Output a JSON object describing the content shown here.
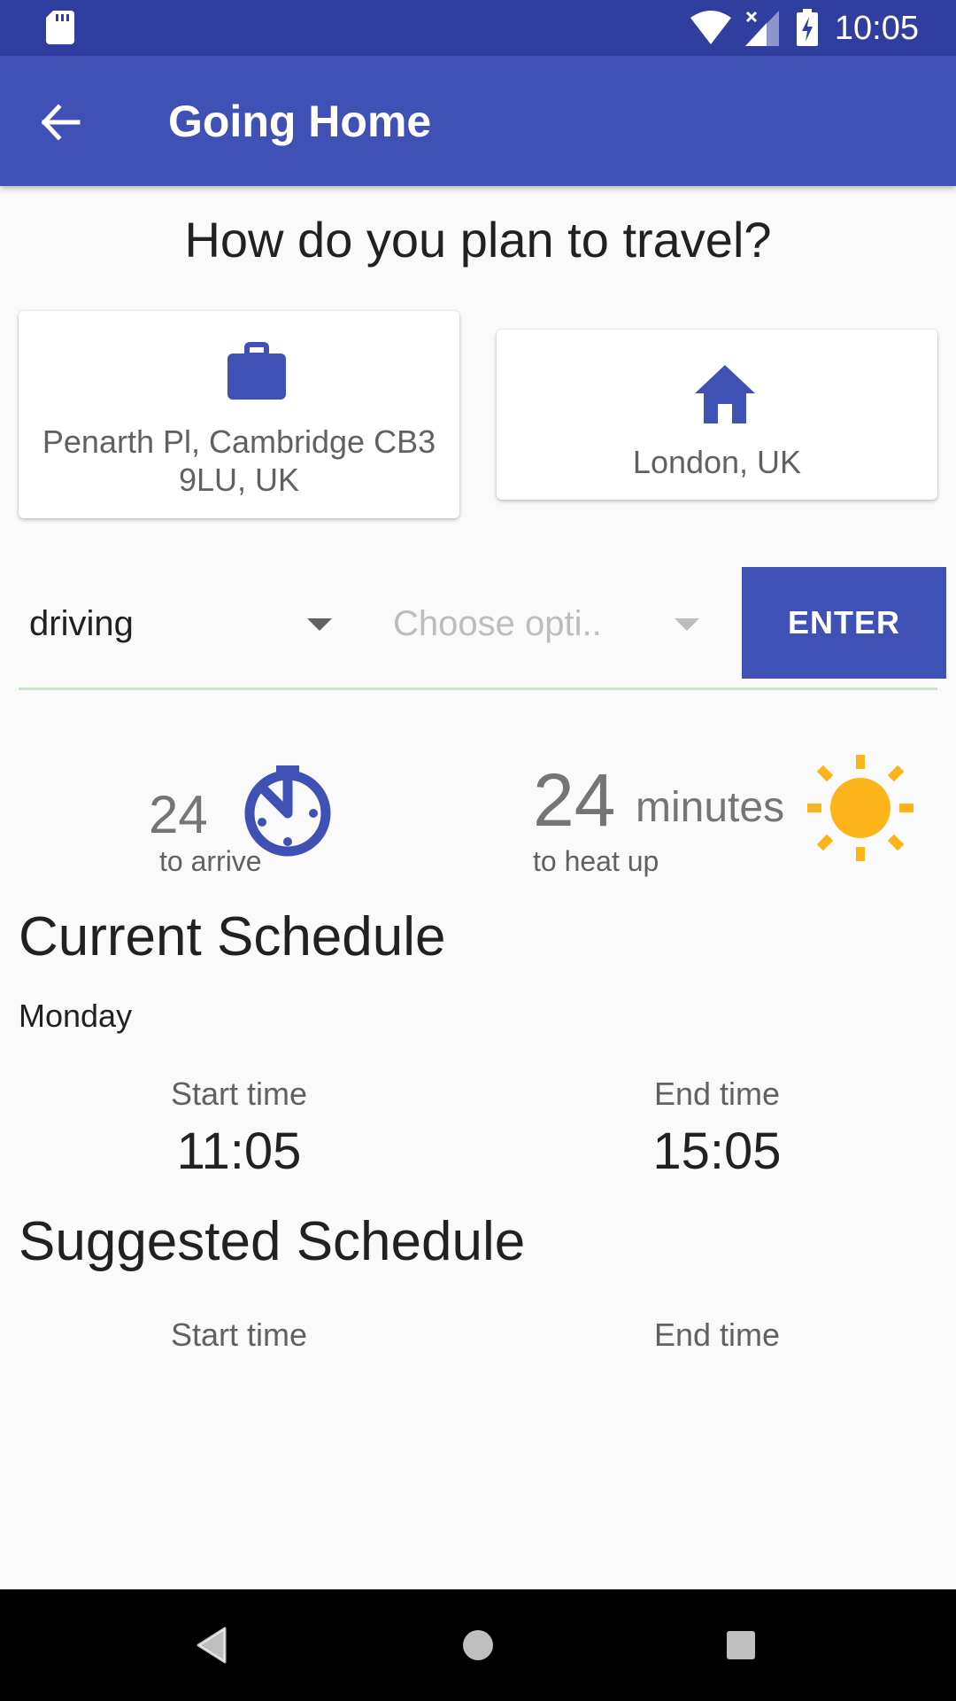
{
  "status_bar": {
    "time": "10:05"
  },
  "app_bar": {
    "title": "Going Home"
  },
  "question": "How do you plan to travel?",
  "origin": {
    "label": "Penarth Pl, Cambridge CB3 9LU, UK",
    "icon": "briefcase-icon"
  },
  "destination": {
    "label": "London, UK",
    "icon": "home-icon"
  },
  "travel": {
    "mode_value": "driving",
    "option_placeholder": "Choose opti..",
    "enter_label": "ENTER"
  },
  "stats": {
    "arrive_value": "24",
    "arrive_caption": "to arrive",
    "heat_value": "24",
    "heat_unit": "minutes",
    "heat_caption": "to heat up"
  },
  "current_schedule": {
    "title": "Current Schedule",
    "day": "Monday",
    "start_label": "Start time",
    "start_time": "11:05",
    "end_label": "End time",
    "end_time": "15:05"
  },
  "suggested_schedule": {
    "title": "Suggested Schedule",
    "start_label": "Start time",
    "end_label": "End time"
  },
  "colors": {
    "primary": "#3f51b5",
    "primary_dark": "#303f9f",
    "sun": "#fbb41a"
  }
}
